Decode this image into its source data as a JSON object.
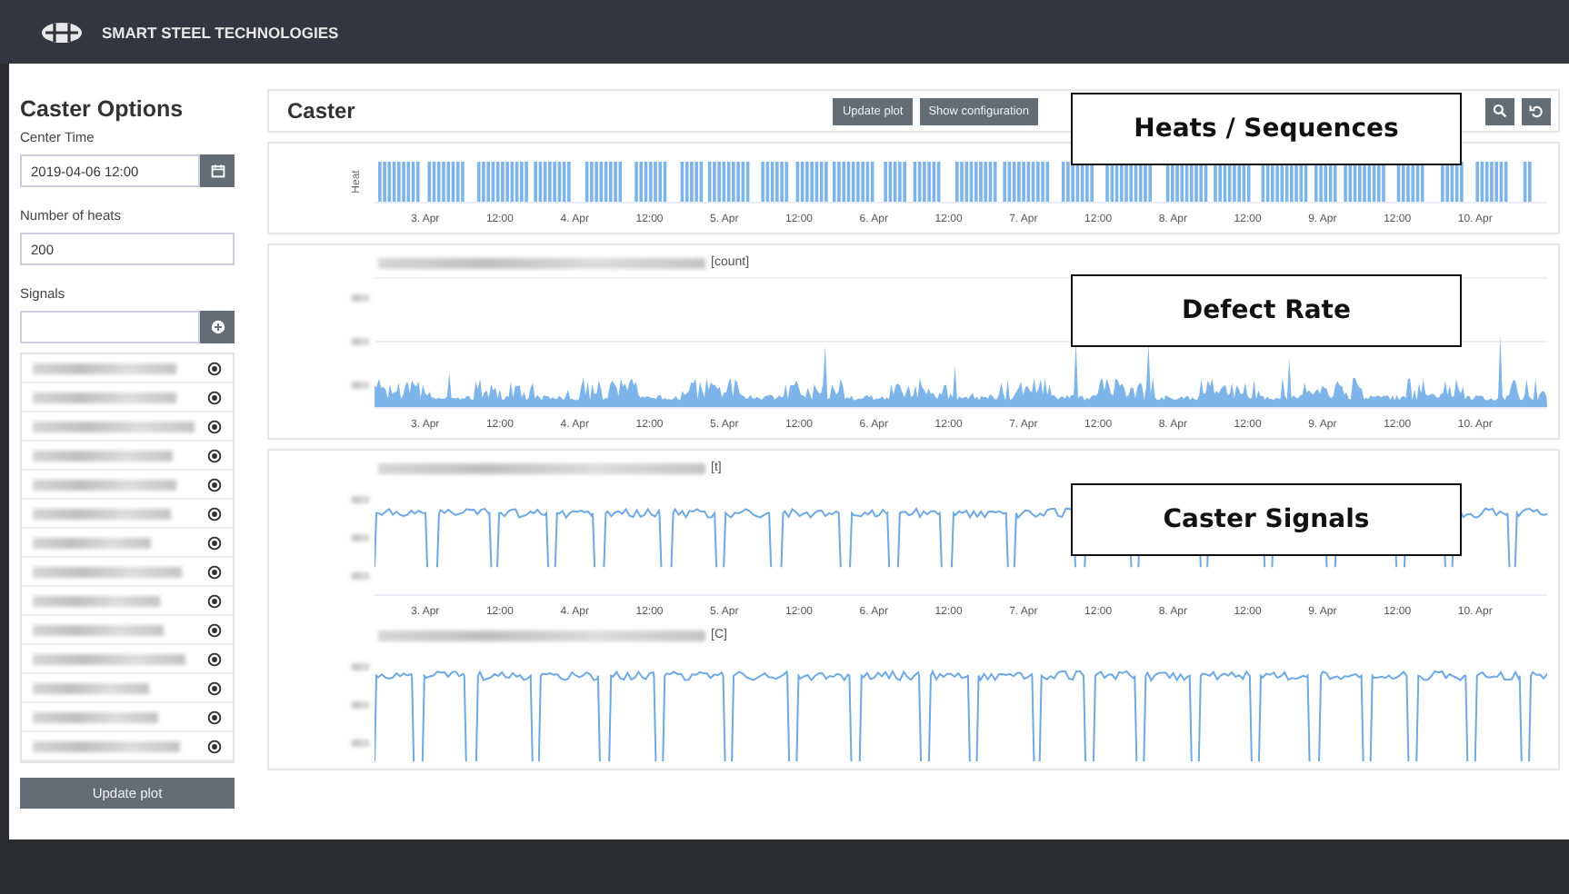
{
  "header": {
    "brand": "SMART STEEL TECHNOLOGIES"
  },
  "sidebar": {
    "title": "Caster Options",
    "fields": [
      {
        "label": "Center Time",
        "value": "2019-04-06 12:00",
        "kind": "date"
      },
      {
        "label": "Number of heats",
        "value": "200",
        "kind": "text"
      }
    ],
    "signals_label": "Signals",
    "signals": [
      {
        "kind": "redacted"
      },
      {
        "kind": "redacted"
      },
      {
        "kind": "redacted"
      },
      {
        "kind": "redacted"
      },
      {
        "kind": "redacted"
      },
      {
        "kind": "redacted"
      },
      {
        "kind": "redacted"
      },
      {
        "kind": "redacted"
      },
      {
        "kind": "redacted"
      },
      {
        "kind": "redacted"
      },
      {
        "kind": "redacted"
      },
      {
        "kind": "redacted"
      },
      {
        "kind": "redacted"
      },
      {
        "kind": "redacted"
      }
    ],
    "button": "Update plot"
  },
  "main": {
    "title": "Caster",
    "buttons": [
      "Update plot",
      "Show configuration"
    ],
    "panels": [
      {
        "charts": [
          {
            "kind": "heats",
            "ylabel": "Heat",
            "x_labels": [
              "3. Apr",
              "12:00",
              "4. Apr",
              "12:00",
              "5. Apr",
              "12:00",
              "6. Apr",
              "12:00",
              "7. Apr",
              "12:00",
              "8. Apr",
              "12:00",
              "9. Apr",
              "12:00",
              "10. Apr"
            ]
          }
        ]
      },
      {
        "charts": [
          {
            "kind": "spikes",
            "unit": "[count]",
            "x_labels": [
              "3. Apr",
              "12:00",
              "4. Apr",
              "12:00",
              "5. Apr",
              "12:00",
              "6. Apr",
              "12:00",
              "7. Apr",
              "12:00",
              "8. Apr",
              "12:00",
              "9. Apr",
              "12:00",
              "10. Apr"
            ]
          }
        ]
      },
      {
        "charts": [
          {
            "kind": "steps",
            "unit": "[t]",
            "x_labels": [
              "3. Apr",
              "12:00",
              "4. Apr",
              "12:00",
              "5. Apr",
              "12:00",
              "6. Apr",
              "12:00",
              "7. Apr",
              "12:00",
              "8. Apr",
              "12:00",
              "9. Apr",
              "12:00",
              "10. Apr"
            ]
          },
          {
            "kind": "steps",
            "unit": "[C]"
          }
        ]
      }
    ]
  },
  "callouts": [
    "Heats / Sequences",
    "Defect Rate",
    "Caster Signals"
  ]
}
